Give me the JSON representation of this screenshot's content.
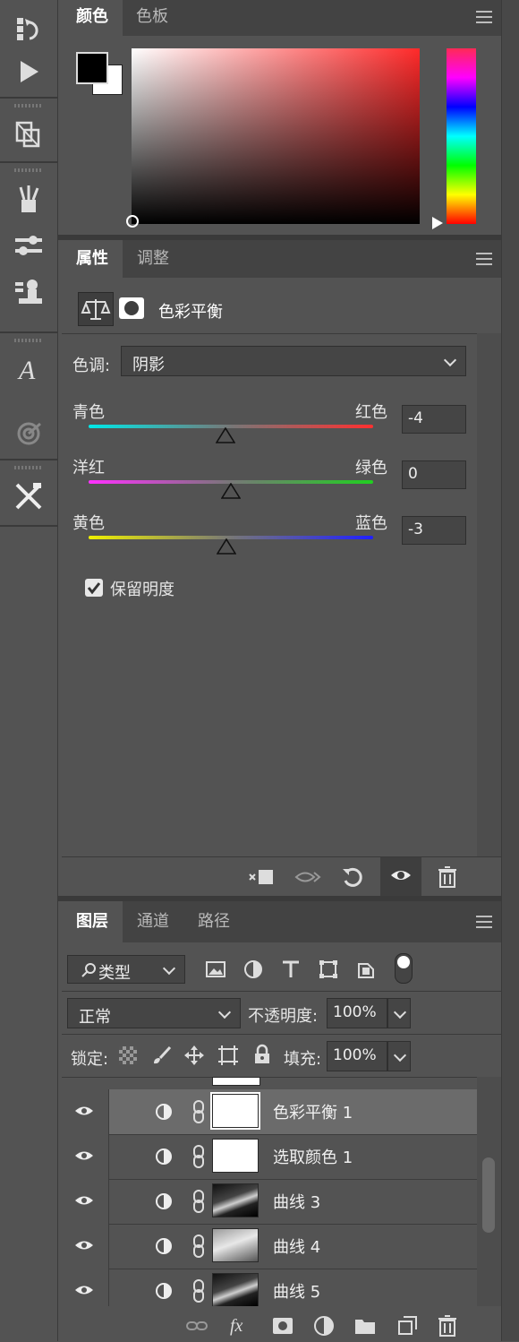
{
  "color_panel": {
    "tabs": [
      "颜色",
      "色板"
    ],
    "foreground_color": "#000000",
    "background_color": "#ffffff",
    "hue_color": "#ff2a2a"
  },
  "properties_panel": {
    "tabs": [
      "属性",
      "调整"
    ],
    "adjustment_name": "色彩平衡",
    "tone_label": "色调:",
    "tone_value": "阴影",
    "sliders": [
      {
        "left_label": "青色",
        "right_label": "红色",
        "value": "-4",
        "position": -4
      },
      {
        "left_label": "洋红",
        "right_label": "绿色",
        "value": "0",
        "position": 0
      },
      {
        "left_label": "黄色",
        "right_label": "蓝色",
        "value": "-3",
        "position": -3
      }
    ],
    "preserve_luminosity_label": "保留明度",
    "preserve_luminosity_checked": true
  },
  "layers_panel": {
    "tabs": [
      "图层",
      "通道",
      "路径"
    ],
    "filter_label": "类型",
    "blend_mode": "正常",
    "opacity_label": "不透明度:",
    "opacity_value": "100%",
    "lock_label": "锁定:",
    "fill_label": "填充:",
    "fill_value": "100%",
    "layers": [
      {
        "name": "色彩平衡 1",
        "selected": true,
        "thumb": "white"
      },
      {
        "name": "选取颜色 1",
        "selected": false,
        "thumb": "white"
      },
      {
        "name": "曲线 3",
        "selected": false,
        "thumb": "photo-dark"
      },
      {
        "name": "曲线 4",
        "selected": false,
        "thumb": "photo-light"
      },
      {
        "name": "曲线 5",
        "selected": false,
        "thumb": "photo-dark"
      }
    ]
  }
}
